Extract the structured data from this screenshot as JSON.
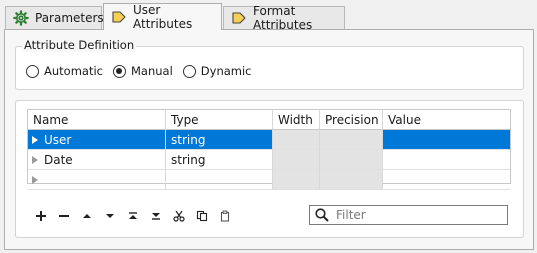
{
  "tabs": [
    {
      "label": "Parameters",
      "icon": "gear-icon",
      "active": false
    },
    {
      "label": "User Attributes",
      "icon": "attribute-arrow-icon",
      "active": true
    },
    {
      "label": "Format Attributes",
      "icon": "attribute-arrow-icon",
      "active": false
    }
  ],
  "attribute_definition": {
    "title": "Attribute Definition",
    "options": [
      {
        "label": "Automatic",
        "selected": false
      },
      {
        "label": "Manual",
        "selected": true
      },
      {
        "label": "Dynamic",
        "selected": false
      }
    ]
  },
  "table": {
    "columns": [
      "Name",
      "Type",
      "Width",
      "Precision",
      "Value"
    ],
    "rows": [
      {
        "name": "User",
        "type": "string",
        "width": "",
        "precision": "",
        "value": "",
        "selected": true
      },
      {
        "name": "Date",
        "type": "string",
        "width": "",
        "precision": "",
        "value": "",
        "selected": false
      },
      {
        "name": "",
        "type": "",
        "width": "",
        "precision": "",
        "value": "",
        "selected": false
      }
    ]
  },
  "toolbar": {
    "buttons": [
      "add-icon",
      "remove-icon",
      "move-up-icon",
      "move-down-icon",
      "move-top-icon",
      "move-bottom-icon",
      "cut-icon",
      "copy-icon",
      "paste-icon"
    ]
  },
  "filter": {
    "placeholder": "Filter",
    "value": ""
  },
  "colors": {
    "selection": "#0078d7",
    "disabled_cell": "#e3e3e3",
    "gear_green": "#2e7d32",
    "tab_arrow": "#e0a800"
  }
}
